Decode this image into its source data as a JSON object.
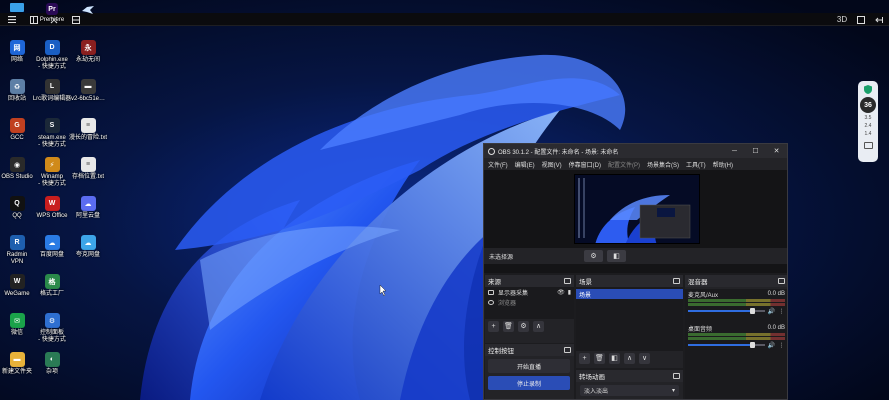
{
  "topbar": {
    "right_labels": [
      "3D"
    ]
  },
  "desktop": {
    "icons": [
      {
        "id": "premiere",
        "label": "Premiere",
        "color": "#2a0a55",
        "glyph": "Pr"
      },
      {
        "id": "network",
        "label": "网络",
        "color": "#1e66d8",
        "glyph": "网"
      },
      {
        "id": "dolphin",
        "label": "Dolphin.exe\n- 快捷方式",
        "color": "#1a5fc4",
        "glyph": "D"
      },
      {
        "id": "yongjie",
        "label": "永劫无间",
        "color": "#8a1f1f",
        "glyph": "永"
      },
      {
        "id": "recycle",
        "label": "回收站",
        "color": "#5d7fa6",
        "glyph": "♻"
      },
      {
        "id": "lrc",
        "label": "Lrc歌词编辑器",
        "color": "#333333",
        "glyph": "L"
      },
      {
        "id": "v2",
        "label": "v2-6bc51e…",
        "color": "#3a3a3a",
        "glyph": "▬"
      },
      {
        "id": "gcc",
        "label": "GCC",
        "color": "#c04020",
        "glyph": "G"
      },
      {
        "id": "steam",
        "label": "steam.exe\n- 快捷方式",
        "color": "#1b2838",
        "glyph": "S"
      },
      {
        "id": "manual",
        "label": "漫长的冒险.txt",
        "color": "#e8e8e8",
        "glyph": "≡"
      },
      {
        "id": "obs",
        "label": "OBS Studio",
        "color": "#2a2a2a",
        "glyph": "◉"
      },
      {
        "id": "winamp",
        "label": "Winamp\n- 快捷方式",
        "color": "#d08a1a",
        "glyph": "⚡"
      },
      {
        "id": "memo",
        "label": "存档位置.txt",
        "color": "#e8e8e8",
        "glyph": "≡"
      },
      {
        "id": "qq",
        "label": "QQ",
        "color": "#111111",
        "glyph": "Q"
      },
      {
        "id": "wps",
        "label": "WPS Office",
        "color": "#c81e1e",
        "glyph": "W"
      },
      {
        "id": "aliyun",
        "label": "阿里云盘",
        "color": "#5b6cf0",
        "glyph": "☁"
      },
      {
        "id": "radmin",
        "label": "Radmin\nVPN",
        "color": "#1e5fae",
        "glyph": "R"
      },
      {
        "id": "baidu",
        "label": "百度网盘",
        "color": "#2a7be4",
        "glyph": "☁"
      },
      {
        "id": "kuake",
        "label": "夸克网盘",
        "color": "#3da5e8",
        "glyph": "☁"
      },
      {
        "id": "wegame",
        "label": "WeGame",
        "color": "#222222",
        "glyph": "W"
      },
      {
        "id": "gszc",
        "label": "格式工厂",
        "color": "#2a8a4a",
        "glyph": "格"
      },
      {
        "id": "wechat",
        "label": "微信",
        "color": "#1aa34a",
        "glyph": "✉"
      },
      {
        "id": "ctrlpanel",
        "label": "控制面板\n- 快捷方式",
        "color": "#2e6fd1",
        "glyph": "⚙"
      },
      {
        "id": "newfolder",
        "label": "新建文件夹",
        "color": "#e8b23a",
        "glyph": "▬"
      },
      {
        "id": "misc",
        "label": "杂项",
        "color": "#2a7b55",
        "glyph": "◐"
      }
    ]
  },
  "widget": {
    "gauge_value": "36",
    "rows": [
      "3.5",
      "2.4",
      "1.4"
    ]
  },
  "obs": {
    "title": "OBS 30.1.2 - 配置文件: 未命名 - 场景: 未命名",
    "menu": [
      {
        "label": "文件(F)",
        "disabled": false
      },
      {
        "label": "编辑(E)",
        "disabled": false
      },
      {
        "label": "视图(V)",
        "disabled": false
      },
      {
        "label": "停靠窗口(D)",
        "disabled": false
      },
      {
        "label": "配置文件(P)",
        "disabled": true
      },
      {
        "label": "场景集合(S)",
        "disabled": false
      },
      {
        "label": "工具(T)",
        "disabled": false
      },
      {
        "label": "帮助(H)",
        "disabled": false
      }
    ],
    "no_source_label": "未选择源",
    "sources": {
      "title": "来源",
      "items": [
        {
          "label": "显示器采集",
          "dim": false
        },
        {
          "label": "浏览器",
          "dim": true
        }
      ]
    },
    "scenes": {
      "title": "场景",
      "items": [
        {
          "label": "场景"
        }
      ]
    },
    "mixer": {
      "title": "混音器",
      "channels": [
        {
          "name": "麦克风/Aux",
          "db": "0.0 dB",
          "level": 0.85
        },
        {
          "name": "桌面音频",
          "db": "0.0 dB",
          "level": 0.85
        }
      ]
    },
    "controls": {
      "title": "控制按钮",
      "start_stream": "开始直播",
      "stop_record": "停止录制"
    },
    "transitions": {
      "title": "转场动画",
      "value": "淡入淡出"
    }
  }
}
